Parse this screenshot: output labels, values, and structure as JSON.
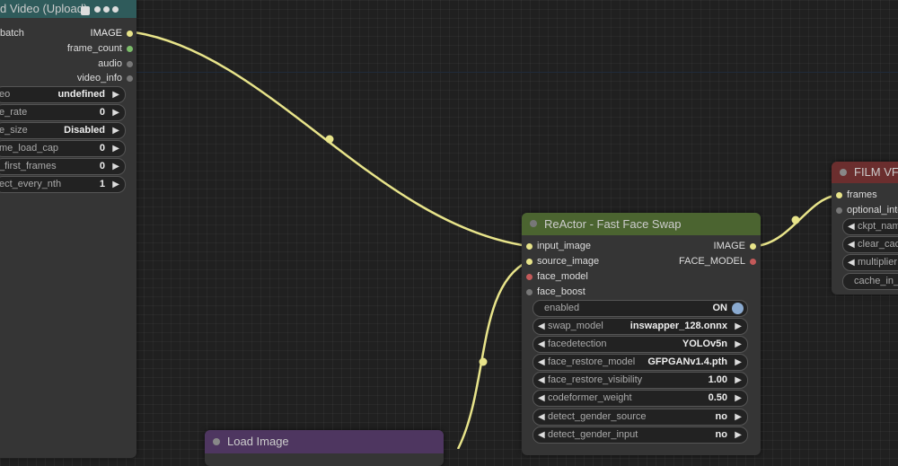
{
  "load_video": {
    "title": "d Video (Upload)",
    "inputs": [
      "batch"
    ],
    "outputs": [
      "IMAGE",
      "frame_count",
      "audio",
      "video_info"
    ],
    "widgets": [
      {
        "label": "eo",
        "value": "undefined"
      },
      {
        "label": "e_rate",
        "value": "0"
      },
      {
        "label": "e_size",
        "value": "Disabled"
      },
      {
        "label": "me_load_cap",
        "value": "0"
      },
      {
        "label": "_first_frames",
        "value": "0"
      },
      {
        "label": "ect_every_nth",
        "value": "1"
      }
    ]
  },
  "reactor": {
    "title": "ReActor - Fast Face Swap",
    "inputs": [
      "input_image",
      "source_image",
      "face_model",
      "face_boost"
    ],
    "outputs": [
      "IMAGE",
      "FACE_MODEL"
    ],
    "toggle": {
      "label": "enabled",
      "value": "ON"
    },
    "widgets": [
      {
        "label": "swap_model",
        "value": "inswapper_128.onnx"
      },
      {
        "label": "facedetection",
        "value": "YOLOv5n"
      },
      {
        "label": "face_restore_model",
        "value": "GFPGANv1.4.pth"
      },
      {
        "label": "face_restore_visibility",
        "value": "1.00"
      },
      {
        "label": "codeformer_weight",
        "value": "0.50"
      },
      {
        "label": "detect_gender_source",
        "value": "no"
      },
      {
        "label": "detect_gender_input",
        "value": "no"
      }
    ]
  },
  "film": {
    "title": "FILM VFI",
    "inputs": [
      "frames",
      "optional_inte"
    ],
    "widgets": [
      "ckpt_nam",
      "clear_cac",
      "multiplier",
      "cache_in_f"
    ]
  },
  "load_image": {
    "title": "Load Image"
  },
  "colors": {
    "link": "#e8e48a",
    "reactor_header": "#4b6430",
    "film_header": "#6b2e2e",
    "load_image_header": "#4e3660",
    "load_video_header": "#2f5b5b"
  }
}
